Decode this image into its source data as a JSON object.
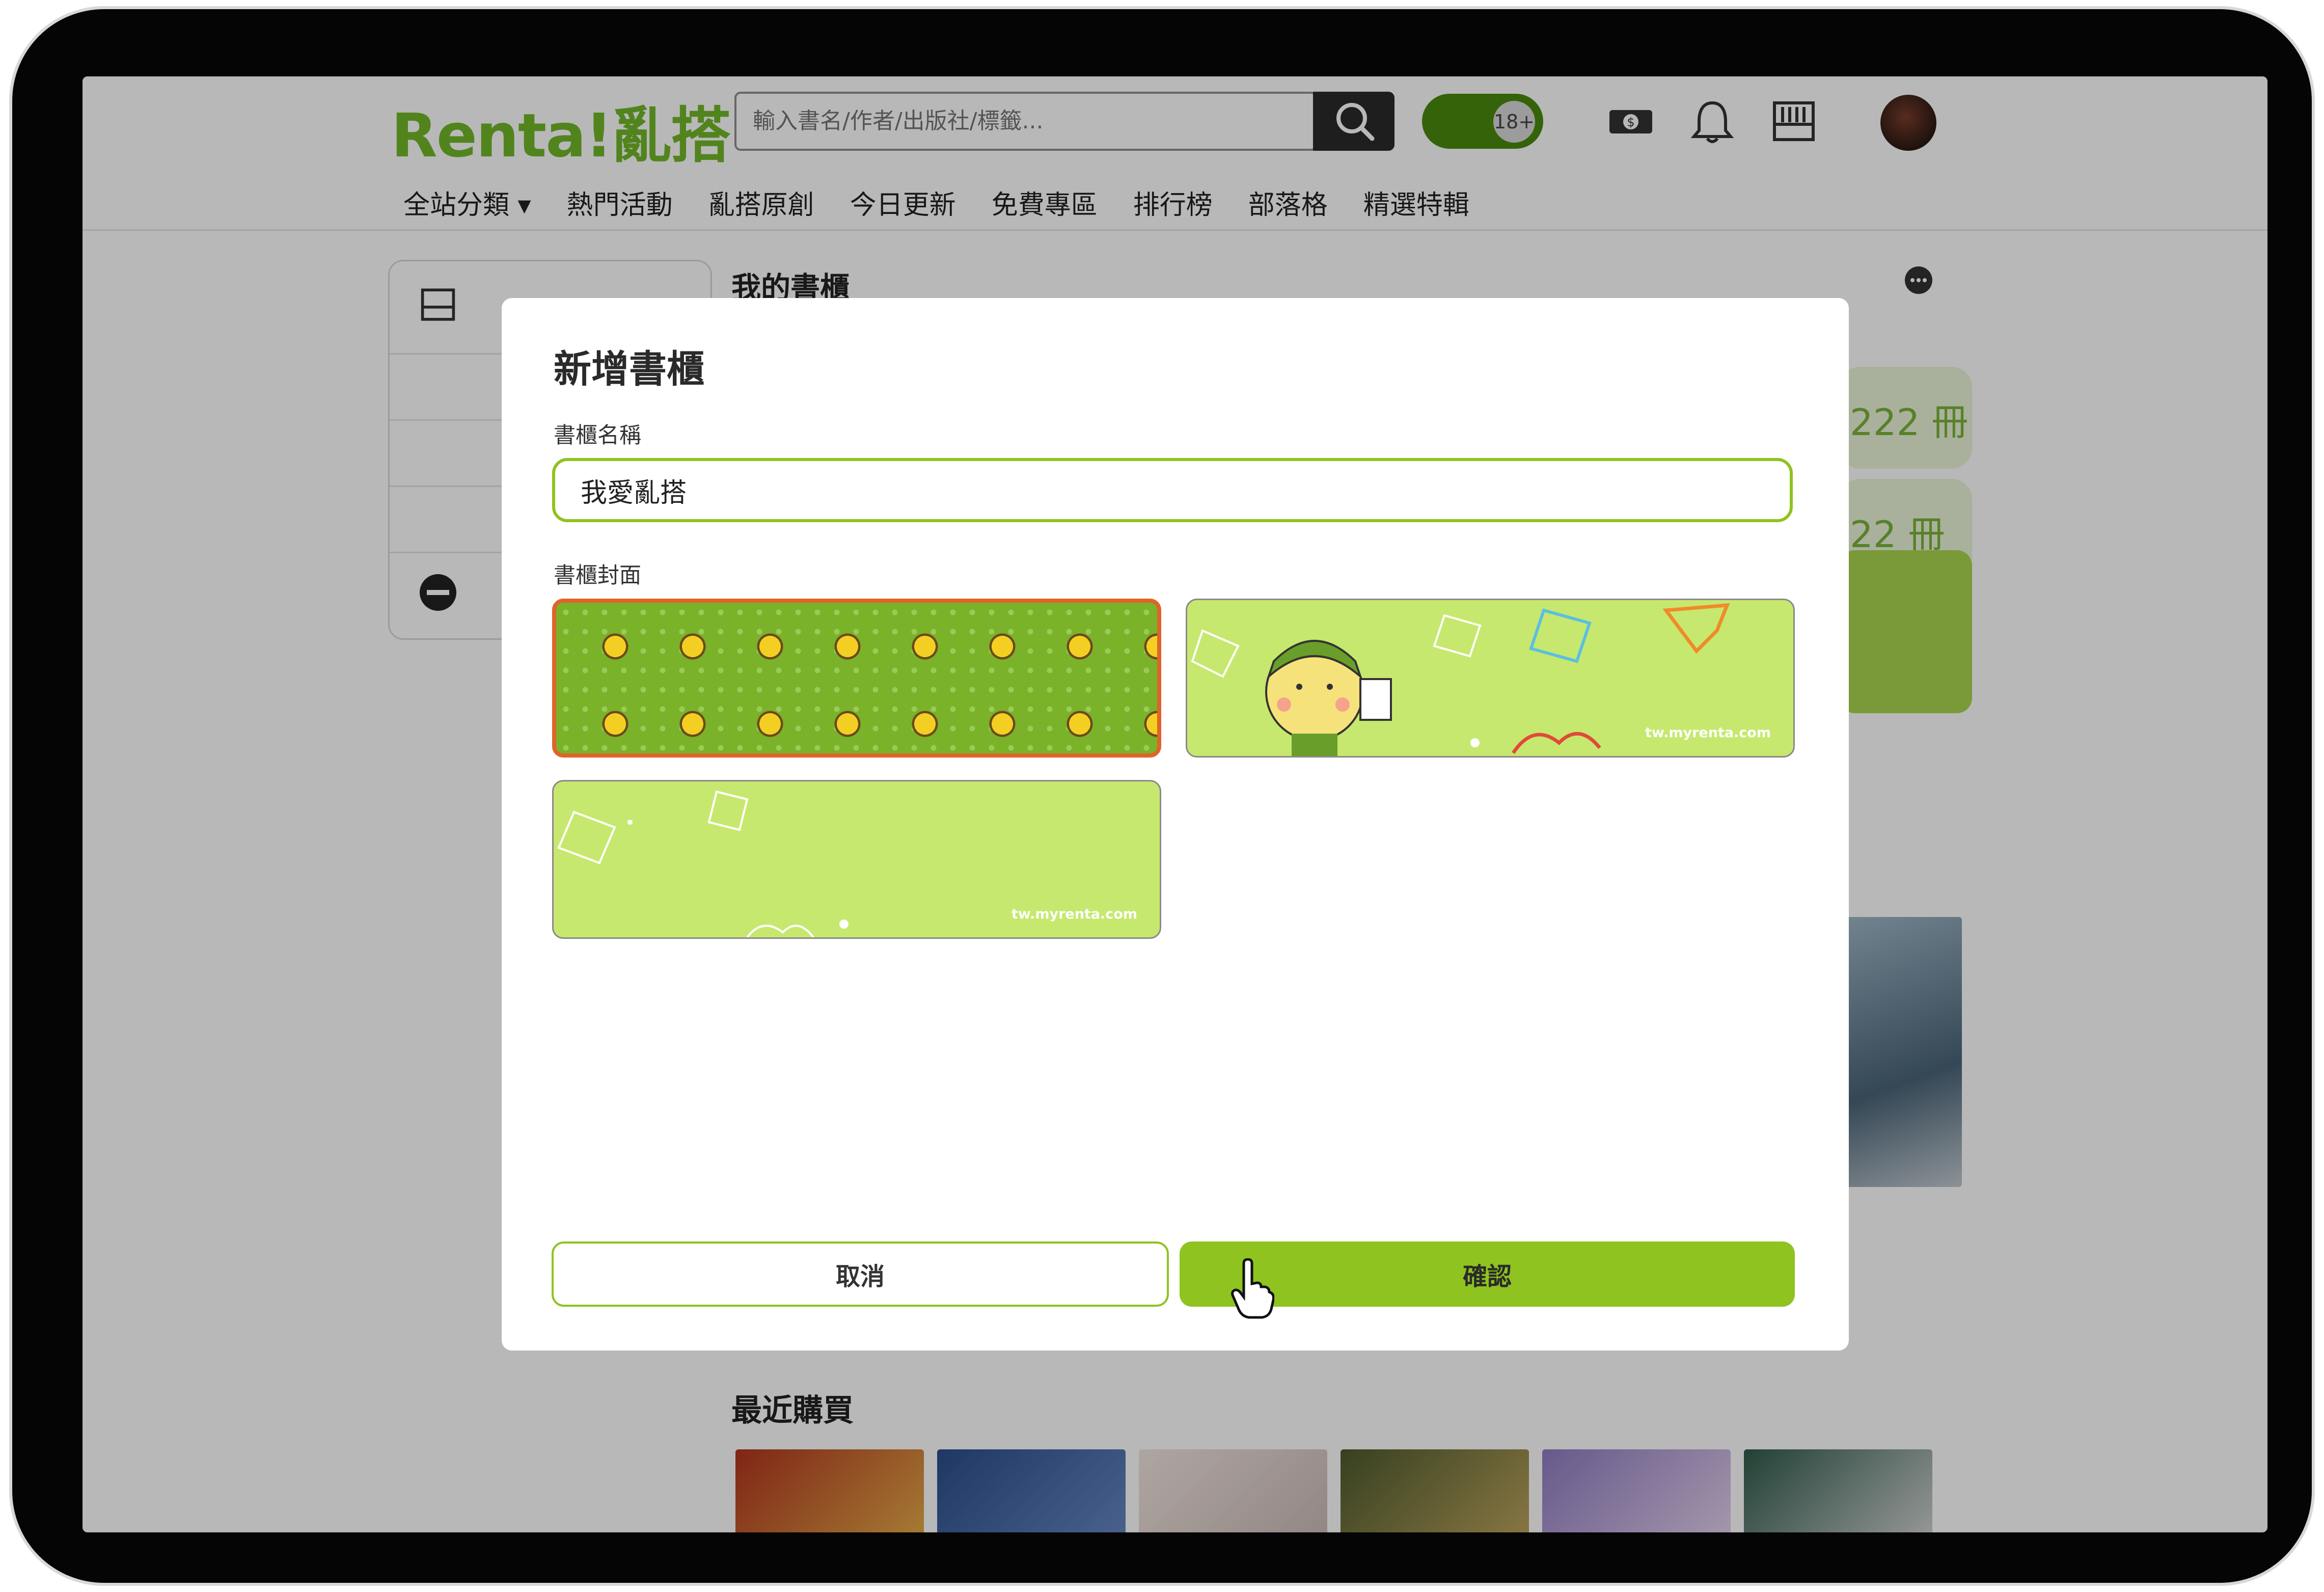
{
  "header": {
    "logo": "Renta!亂搭",
    "search_placeholder": "輸入書名/作者/出版社/標籤...",
    "age_label": "18+",
    "icons": [
      "search-icon",
      "coin-icon",
      "bell-icon",
      "bookshelf-icon"
    ]
  },
  "nav": {
    "items": [
      {
        "label": "全站分類 ▾"
      },
      {
        "label": "熱門活動"
      },
      {
        "label": "亂搭原創"
      },
      {
        "label": "今日更新"
      },
      {
        "label": "免費專區"
      },
      {
        "label": "排行榜"
      },
      {
        "label": "部落格"
      },
      {
        "label": "精選特輯"
      }
    ]
  },
  "page": {
    "title": "我的書櫃",
    "shelf_counts": [
      "222 冊",
      "22 冊"
    ],
    "recent_title": "最近購買"
  },
  "modal": {
    "title": "新增書櫃",
    "name_label": "書櫃名稱",
    "name_value": "我愛亂搭",
    "cover_label": "書櫃封面",
    "cover_url_text": "tw.myrenta.com",
    "cancel_label": "取消",
    "confirm_label": "確認"
  },
  "colors": {
    "brand_green": "#8fc31f",
    "selected_border": "#e0632a",
    "dim_overlay": "rgba(0,0,0,0.28)"
  }
}
